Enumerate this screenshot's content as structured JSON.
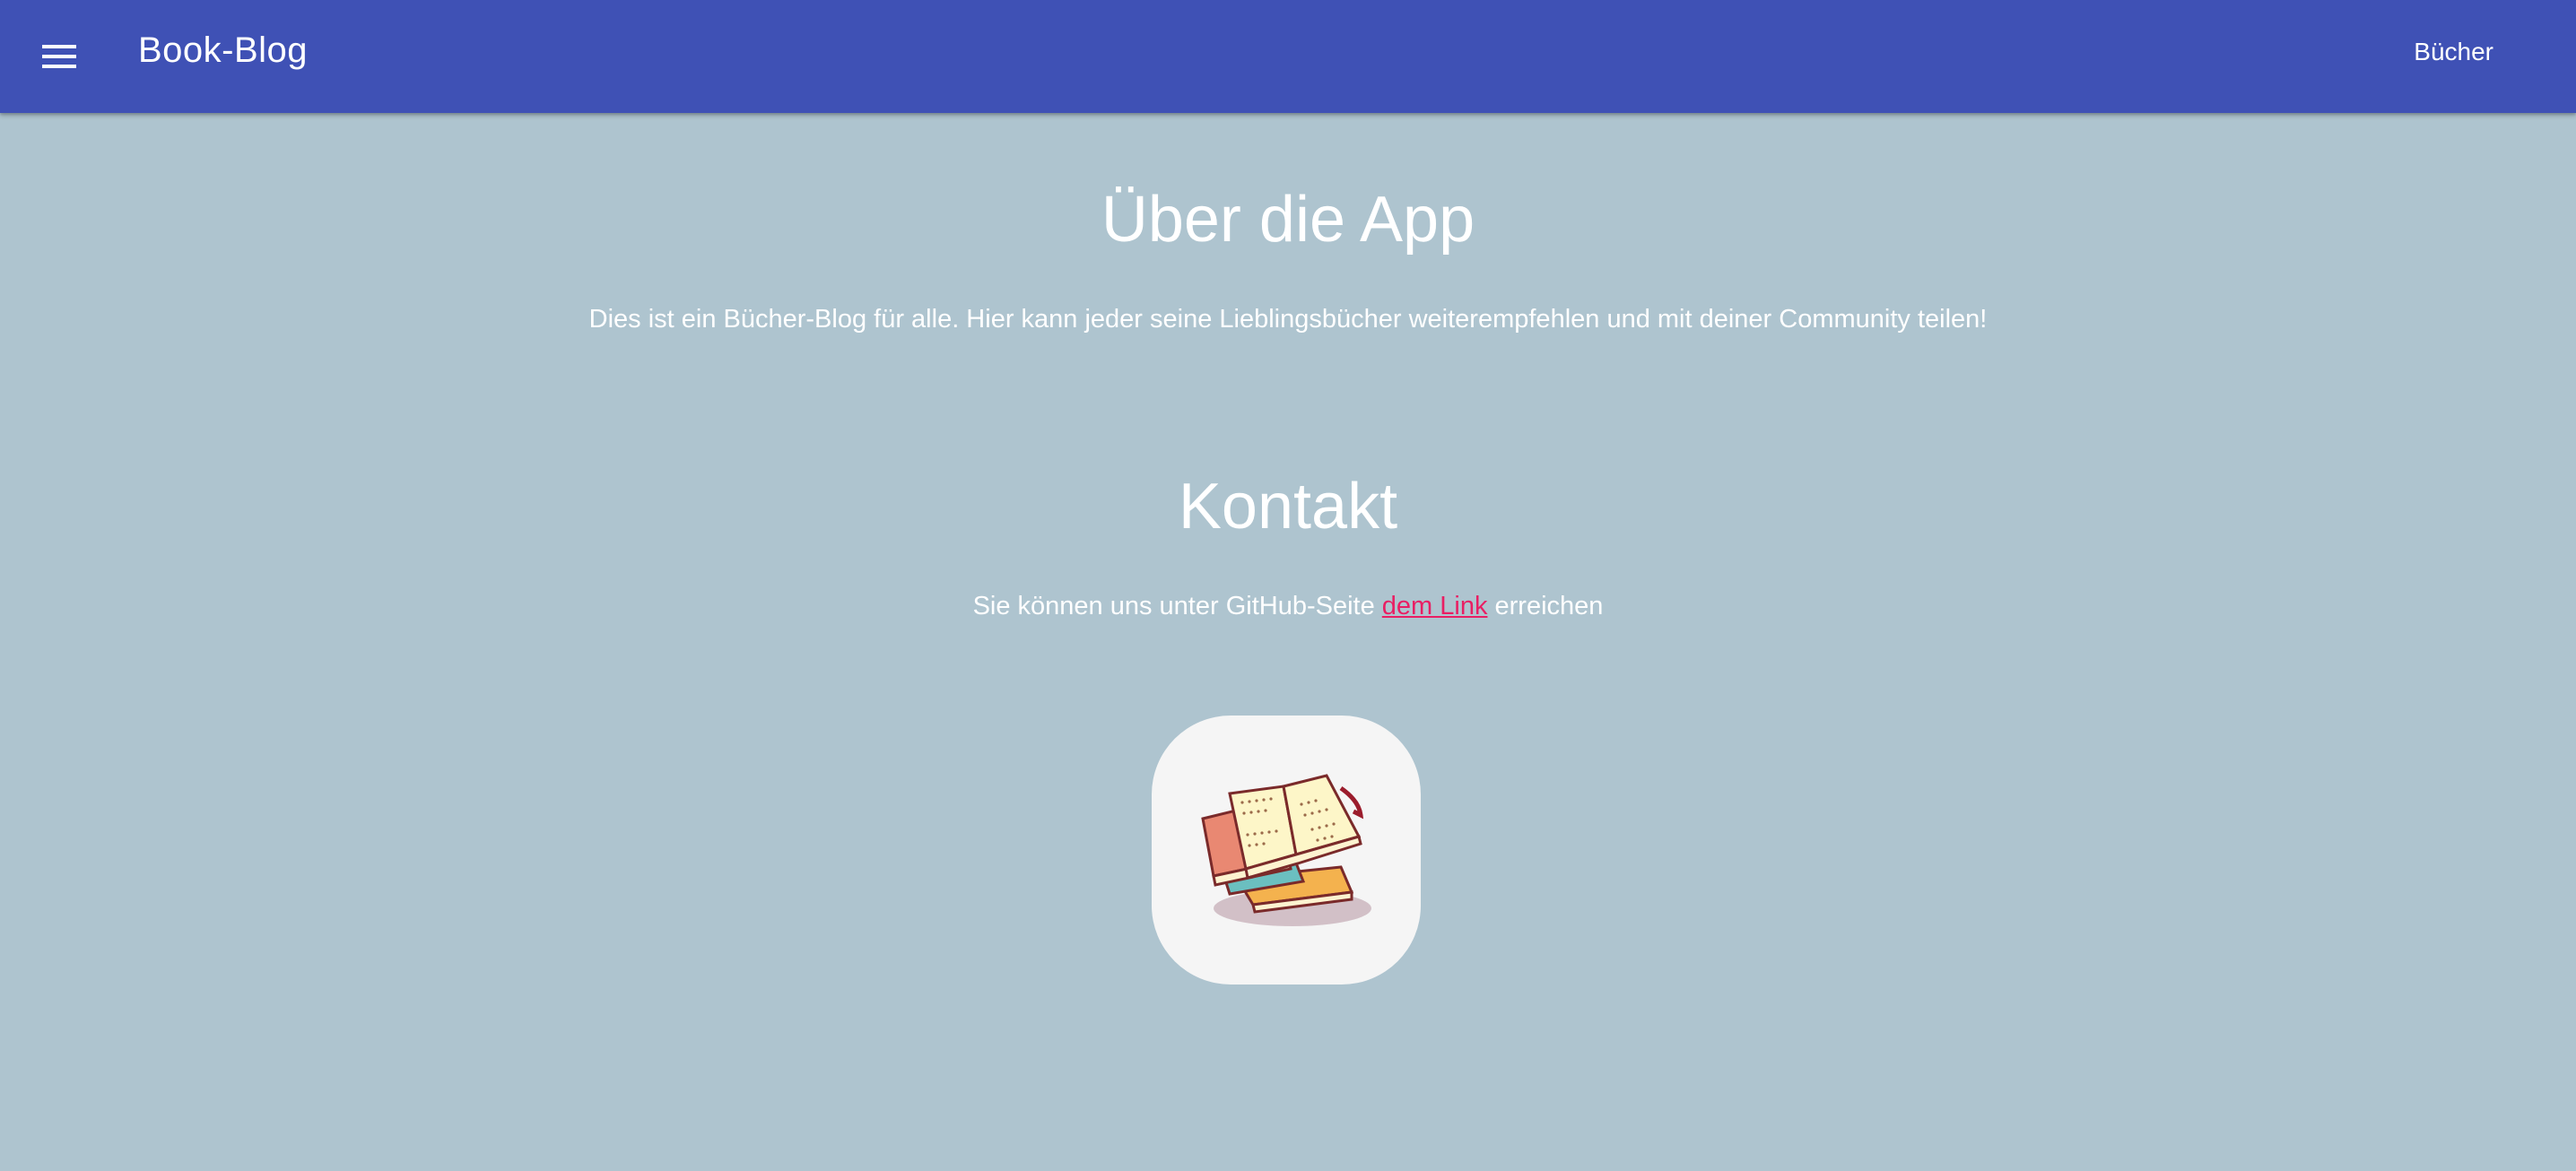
{
  "toolbar": {
    "menu_icon": "menu-icon",
    "title": "Book-Blog",
    "nav_link": "Bücher"
  },
  "about": {
    "title": "Über die App",
    "text": "Dies ist ein Bücher-Blog für alle. Hier kann jeder seine Lieblingsbücher weiterempfehlen und mit deiner Community teilen!"
  },
  "contact": {
    "title": "Kontakt",
    "text_before": "Sie können uns unter GitHub-Seite ",
    "link_label": "dem Link",
    "text_after": " erreichen"
  },
  "logo": {
    "icon": "books-icon"
  },
  "colors": {
    "toolbar": "#3f51b5",
    "background": "#aec4cf",
    "link": "#e91e63",
    "logo_card": "#f5f5f5"
  }
}
